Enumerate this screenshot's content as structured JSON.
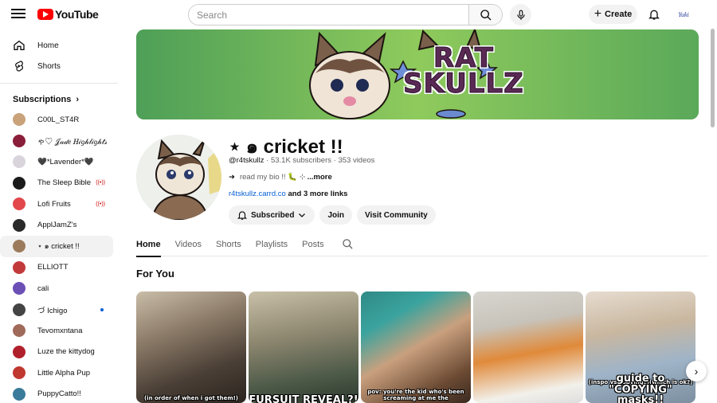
{
  "header": {
    "logo_text": "YouTube",
    "search_placeholder": "Search",
    "create_label": "Create",
    "account_avatar_text": "Yuki"
  },
  "sidebar": {
    "items": [
      {
        "label": "Home",
        "icon": "home-icon"
      },
      {
        "label": "Shorts",
        "icon": "shorts-icon"
      }
    ],
    "subscriptions_title": "Subscriptions",
    "subscriptions": [
      {
        "name": "C00L_ST4R",
        "color": "#c9a27a",
        "status": ""
      },
      {
        "name": "ゃ♡ 𝒥𝒶𝒹𝑒 𝐻𝒾𝑔𝒽𝓁𝒾𝑔𝒽𝓉𝓈",
        "color": "#8a1e3a",
        "status": ""
      },
      {
        "name": "🖤*Lavender*🖤",
        "color": "#d9d4dc",
        "status": ""
      },
      {
        "name": "The Sleep Bible",
        "color": "#1b1b1b",
        "status": "live"
      },
      {
        "name": "Lofi Fruits",
        "color": "#e2474b",
        "status": "live"
      },
      {
        "name": "ApplJamZ's",
        "color": "#2a2a2a",
        "status": ""
      },
      {
        "name": "⋆ ๑ cricket !!",
        "color": "#9c7b5c",
        "status": "active"
      },
      {
        "name": "ELLIOTT",
        "color": "#c33a3a",
        "status": ""
      },
      {
        "name": "cali",
        "color": "#6b4fb5",
        "status": ""
      },
      {
        "name": "づ Ichigo",
        "color": "#444444",
        "status": "new"
      },
      {
        "name": "Tevomxntana",
        "color": "#a06a5a",
        "status": ""
      },
      {
        "name": "Luze the kittydog",
        "color": "#b0202a",
        "status": ""
      },
      {
        "name": "Little Alpha Pup",
        "color": "#c0372f",
        "status": ""
      },
      {
        "name": "PuppyCatto!!",
        "color": "#3a7a9a",
        "status": ""
      }
    ],
    "live_icon": "broadcast-icon"
  },
  "channel": {
    "banner_line1": "RAT",
    "banner_line2": "SKULLZ",
    "name": "⋆ ๑ cricket !!",
    "handle": "@r4tskullz",
    "subscribers": "53.1K subscribers",
    "videos": "353 videos",
    "bio": "read my bio !! 🐛 ⊹",
    "bio_more": "...more",
    "link": "r4tskullz.carrd.co",
    "more_links": "and 3 more links",
    "subscribed_label": "Subscribed",
    "join_label": "Join",
    "community_label": "Visit Community"
  },
  "tabs": [
    "Home",
    "Videos",
    "Shorts",
    "Playlists",
    "Posts"
  ],
  "section_title": "For You",
  "shorts": [
    {
      "caption": "(in order of when i got them!)",
      "big": "",
      "bg": "linear-gradient(160deg,#c9bda8 0%,#8c7b68 35%,#4a3f36 70%,#2b241f 100%)"
    },
    {
      "caption": "",
      "big": "FURSUIT REVEAL?!",
      "bg": "linear-gradient(170deg,#c8c0a8 0%,#8e8770 40%,#4d5a48 75%,#2d3a2f 100%)"
    },
    {
      "caption": "pov: you're the kid who's been screaming at me the",
      "big": "",
      "bg": "linear-gradient(150deg,#2f8a86 0%,#3ba39e 25%,#c9a07e 50%,#6b4a33 80%,#3a2a20 100%)"
    },
    {
      "caption": "",
      "big": "",
      "bg": "linear-gradient(170deg,#d8d6d0 0%,#c7c3ba 30%,#e08a3a 55%,#f2f0ea 85%,#ddd 100%)"
    },
    {
      "caption": "(inspo vs copying?)(which is ok?)",
      "big": "guide to \"COPYING\" masks!!",
      "bg": "linear-gradient(170deg,#e6dcd0 0%,#c9b79f 35%,#9fb4c8 65%,#7d8fa0 100%)"
    }
  ]
}
